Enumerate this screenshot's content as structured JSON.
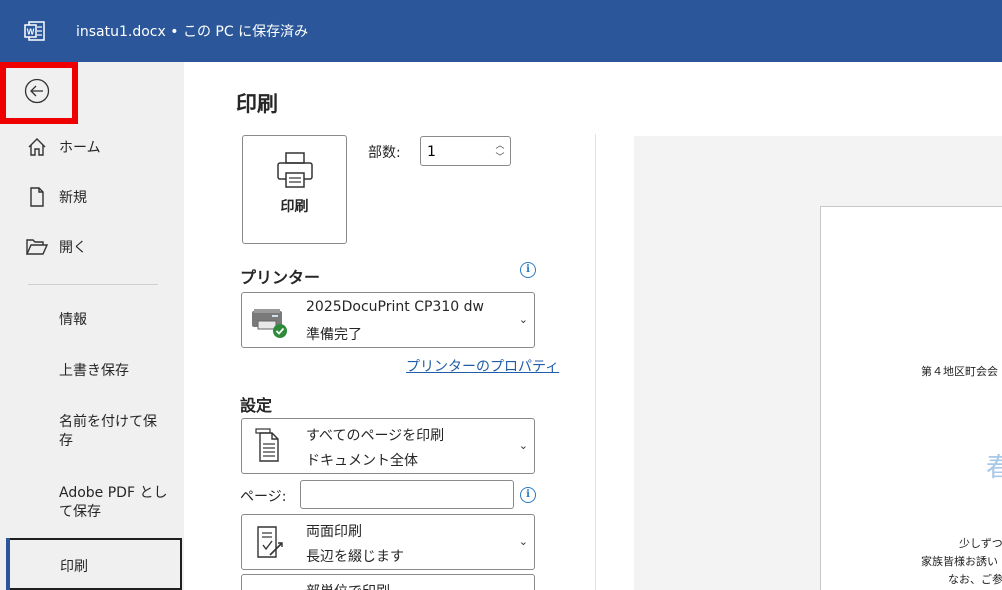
{
  "titlebar": {
    "doc_title": "insatu1.docx • この PC に保存済み",
    "accent": "#2b579a"
  },
  "sidebar": {
    "back_icon": "back-arrow-icon",
    "home": "ホーム",
    "new": "新規",
    "open": "開く",
    "info": "情報",
    "save": "上書き保存",
    "save_as": "名前を付けて保存",
    "adobe_pdf": "Adobe PDF として保存",
    "print": "印刷"
  },
  "main": {
    "title": "印刷",
    "print_button": "印刷",
    "copies_label": "部数:",
    "copies_value": "1",
    "printer_header": "プリンター",
    "printer_name": "2025DocuPrint CP310 dw",
    "printer_status": "準備完了",
    "printer_props": "プリンターのプロパティ",
    "settings_header": "設定",
    "range_line1": "すべてのページを印刷",
    "range_line2": "ドキュメント全体",
    "pages_label": "ページ:",
    "pages_value": "",
    "duplex_line1": "両面印刷",
    "duplex_line2": "長辺を綴じます",
    "collate_line1": "部単位で印刷"
  },
  "preview": {
    "line1": "第４地区町会会",
    "big": "春",
    "line2": "少しずつ暖",
    "line3": "家族皆様お誘い",
    "line4": "なお、ご参"
  }
}
